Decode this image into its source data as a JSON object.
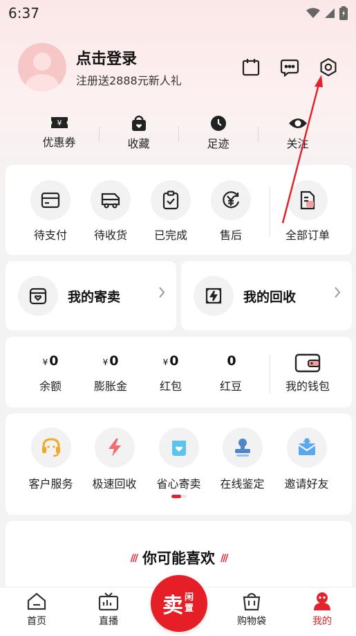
{
  "status": {
    "time": "6:37"
  },
  "profile": {
    "title": "点击登录",
    "subtitle": "注册送2888元新人礼"
  },
  "top_icons": [
    "calendar-icon",
    "message-icon",
    "settings-icon"
  ],
  "quick": [
    {
      "label": "优惠券",
      "icon": "coupon-icon"
    },
    {
      "label": "收藏",
      "icon": "favorite-bag-icon"
    },
    {
      "label": "足迹",
      "icon": "clock-icon"
    },
    {
      "label": "关注",
      "icon": "eye-icon"
    }
  ],
  "orders": [
    {
      "label": "待支付",
      "icon": "card-icon"
    },
    {
      "label": "待收货",
      "icon": "truck-icon"
    },
    {
      "label": "已完成",
      "icon": "clipboard-check-icon"
    },
    {
      "label": "售后",
      "icon": "yen-refresh-icon"
    },
    {
      "label": "全部订单",
      "icon": "document-icon"
    }
  ],
  "consign": {
    "title": "我的寄卖"
  },
  "recycle": {
    "title": "我的回收"
  },
  "wallet": {
    "items": [
      {
        "currency": "¥",
        "value": "0",
        "label": "余额"
      },
      {
        "currency": "¥",
        "value": "0",
        "label": "膨胀金"
      },
      {
        "currency": "¥",
        "value": "0",
        "label": "红包"
      },
      {
        "currency": "",
        "value": "0",
        "label": "红豆"
      }
    ],
    "my_wallet": "我的钱包"
  },
  "services": [
    {
      "label": "客户服务",
      "icon": "headset-icon"
    },
    {
      "label": "极速回收",
      "icon": "lightning-icon"
    },
    {
      "label": "省心寄卖",
      "icon": "heart-bag-icon"
    },
    {
      "label": "在线鉴定",
      "icon": "stamp-icon"
    },
    {
      "label": "邀请好友",
      "icon": "invite-mail-icon"
    }
  ],
  "recommend": {
    "title": "你可能喜欢"
  },
  "tabs": [
    {
      "label": "首页",
      "icon": "home-icon"
    },
    {
      "label": "直播",
      "icon": "tv-icon"
    },
    {
      "label": "购物袋",
      "icon": "shopping-bag-icon"
    },
    {
      "label": "我的",
      "icon": "profile-icon"
    }
  ],
  "sell": {
    "big": "卖",
    "small": "闲置"
  },
  "colors": {
    "accent": "#e3232c",
    "sell_button": "#e61e25"
  }
}
